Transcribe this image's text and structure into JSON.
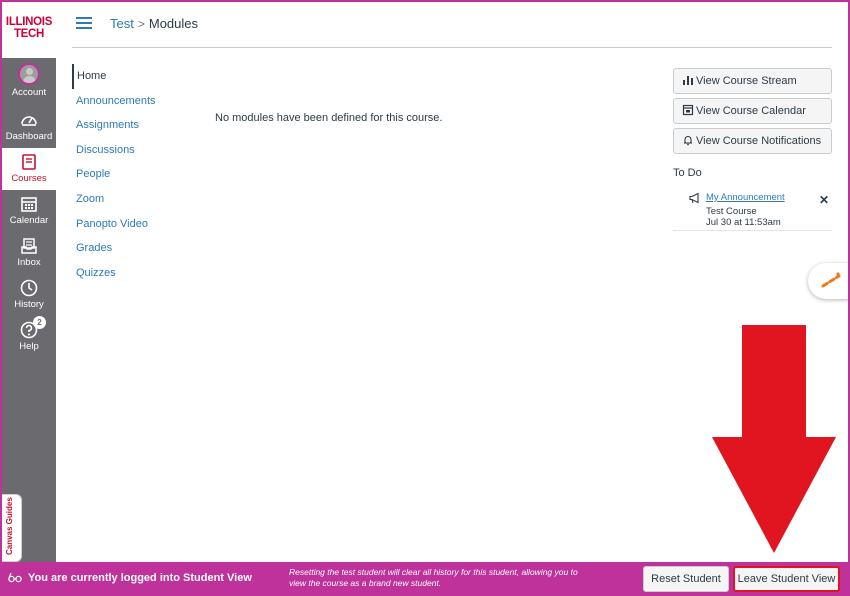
{
  "logo": {
    "line1": "ILLINOIS",
    "line2": "TECH"
  },
  "global_nav": {
    "items": [
      {
        "label": "Account",
        "icon": "account-avatar-icon"
      },
      {
        "label": "Dashboard",
        "icon": "dashboard-gauge-icon"
      },
      {
        "label": "Courses",
        "icon": "courses-book-icon"
      },
      {
        "label": "Calendar",
        "icon": "calendar-icon"
      },
      {
        "label": "Inbox",
        "icon": "inbox-icon"
      },
      {
        "label": "History",
        "icon": "history-clock-icon"
      },
      {
        "label": "Help",
        "icon": "help-question-icon",
        "badge": "2"
      }
    ]
  },
  "breadcrumb": {
    "course": "Test",
    "separator": ">",
    "current": "Modules"
  },
  "course_nav": {
    "items": [
      "Home",
      "Announcements",
      "Assignments",
      "Discussions",
      "People",
      "Zoom",
      "Panopto Video",
      "Grades",
      "Quizzes"
    ]
  },
  "main": {
    "empty_message": "No modules have been defined for this course."
  },
  "sidebar": {
    "buttons": [
      {
        "label": "View Course Stream",
        "icon": "bar-chart-icon"
      },
      {
        "label": "View Course Calendar",
        "icon": "calendar-icon"
      },
      {
        "label": "View Course Notifications",
        "icon": "bell-icon"
      }
    ],
    "todo_heading": "To Do",
    "todo": {
      "title": "My Announcement",
      "course": "Test Course",
      "date": "Jul 30 at 11:53am",
      "dismiss": "✕",
      "icon": "megaphone-icon"
    }
  },
  "guides_tab": {
    "label": "Canvas Guides"
  },
  "student_view": {
    "icon": "student-view-glasses-icon",
    "message": "You are currently logged into Student View",
    "note": "Resetting the test student will clear all history for this student, allowing you to view the course as a brand new student.",
    "reset_label": "Reset Student",
    "leave_label": "Leave Student View"
  },
  "colors": {
    "brand_red": "#cc0033",
    "nav_gray": "#6b6b6f",
    "link_blue": "#2d7ab7",
    "student_bar": "#c0329b",
    "arrow_red": "#e0151f"
  }
}
